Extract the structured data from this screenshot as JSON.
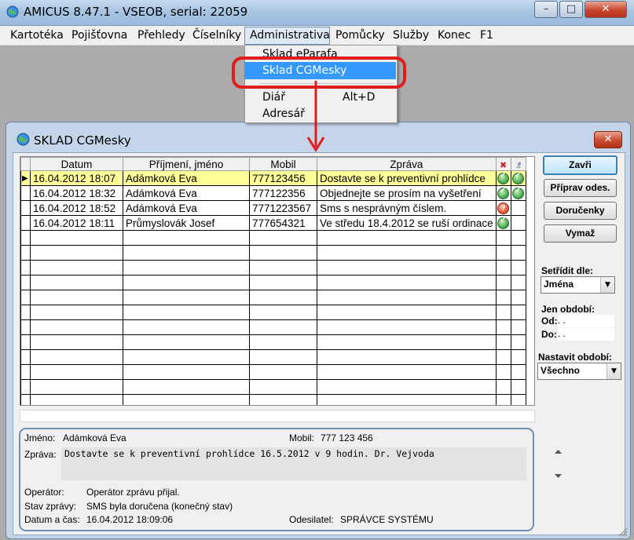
{
  "main_window": {
    "title": "AMICUS  8.47.1  -  VSEOB, serial: 22059",
    "minimize": "–",
    "maximize": "□",
    "close": "✕"
  },
  "menu": [
    "Kartotéka",
    "Pojišťovna",
    "Přehledy",
    "Číselníky",
    "Administrativa",
    "Pomůcky",
    "Služby",
    "Konec",
    "F1"
  ],
  "dropdown": {
    "items": [
      {
        "label": "Sklad eParafa",
        "shortcut": ""
      },
      {
        "label": "Sklad CGMesky",
        "shortcut": ""
      },
      {
        "label": "Diář",
        "shortcut": "Alt+D"
      },
      {
        "label": "Adresář",
        "shortcut": ""
      }
    ]
  },
  "dialog": {
    "title": "SKLAD CGMesky",
    "close": "✕",
    "columns": [
      "Datum",
      "Příjmení, jméno",
      "Mobil",
      "Zpráva"
    ],
    "rows": [
      {
        "datum": "16.04.2012 18:07",
        "jmeno": "Adámková Eva",
        "mobil": "777123456",
        "zprava": "Dostavte se k preventivní prohlídce",
        "s1": "ok",
        "s2": "ok"
      },
      {
        "datum": "16.04.2012 18:32",
        "jmeno": "Adámková Eva",
        "mobil": "777122356",
        "zprava": "Objednejte se prosím na vyšetření",
        "s1": "ok",
        "s2": "ok"
      },
      {
        "datum": "16.04.2012 18:52",
        "jmeno": "Adámková Eva",
        "mobil": "7771223567",
        "zprava": "Sms s nesprávným číslem.",
        "s1": "err",
        "s2": ""
      },
      {
        "datum": "16.04.2012 18:11",
        "jmeno": "Průmyslovák Josef",
        "mobil": "777654321",
        "zprava": "Ve středu 18.4.2012 se ruší ordinace",
        "s1": "ok",
        "s2": ""
      }
    ],
    "buttons": {
      "zavri": "Zavři",
      "priprav": "Příprav odes.",
      "dorucenky": "Doručenky",
      "vymaz": "Vymaž"
    },
    "sort": {
      "label": "Setřídit dle:",
      "value": "Jména"
    },
    "period": {
      "label": "Jen období:",
      "od_label": "Od:",
      "od_value": " .  .",
      "do_label": "Do:",
      "do_value": " .  ."
    },
    "set_period": {
      "label": "Nastavit období:",
      "value": "Všechno"
    },
    "detail": {
      "jmeno_label": "Jméno:",
      "jmeno": "Adámková Eva",
      "mobil_label": "Mobil:",
      "mobil": "777 123 456",
      "zprava_label": "Zpráva:",
      "zprava": "Dostavte se k preventivní prohlídce 16.5.2012 v 9 hodin. Dr. Vejvoda",
      "operator_label": "Operátor:",
      "operator": "Operátor zprávu přijal.",
      "stav_label": "Stav zprávy:",
      "stav": "SMS byla doručena (konečný stav)",
      "datum_label": "Datum a čas:",
      "datum": "16.04.2012 18:09:06",
      "odesilatel_label": "Odesilatel:",
      "odesilatel": "SPRÁVCE SYSTÉMU"
    }
  },
  "colors": {
    "highlight": "#3399ff",
    "annotation_red": "#e11c1c",
    "selected_row": "#ffff99"
  }
}
